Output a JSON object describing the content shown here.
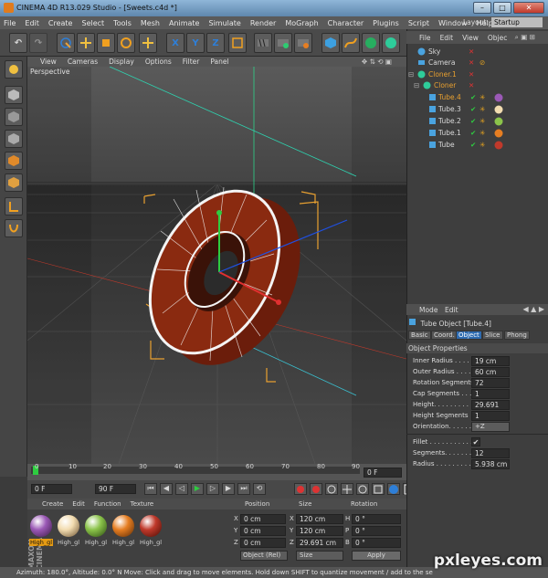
{
  "window": {
    "title": "CINEMA 4D R13.029 Studio - [Sweets.c4d *]"
  },
  "menu": [
    "File",
    "Edit",
    "Create",
    "Select",
    "Tools",
    "Mesh",
    "Animate",
    "Simulate",
    "Render",
    "MoGraph",
    "Character",
    "Plugins",
    "Script",
    "Window",
    "Help"
  ],
  "layout": {
    "label": "Layout:",
    "value": "Startup"
  },
  "toolbar": {
    "x_label": "X",
    "y_label": "Y",
    "z_label": "Z"
  },
  "viewport": {
    "menu": [
      "View",
      "Cameras",
      "Display",
      "Options",
      "Filter",
      "Panel"
    ],
    "label": "Perspective"
  },
  "object_manager": {
    "menu": [
      "File",
      "Edit",
      "View",
      "Objec"
    ],
    "objects": [
      {
        "name": "Sky"
      },
      {
        "name": "Camera"
      },
      {
        "name": "Cloner.1"
      },
      {
        "name": "Cloner"
      },
      {
        "name": "Tube.4"
      },
      {
        "name": "Tube.3"
      },
      {
        "name": "Tube.2"
      },
      {
        "name": "Tube.1"
      },
      {
        "name": "Tube"
      }
    ]
  },
  "attributes": {
    "menu": [
      "Mode",
      "Edit"
    ],
    "title": "Tube Object [Tube.4]",
    "tabs": [
      "Basic",
      "Coord.",
      "Object",
      "Slice",
      "Phong"
    ],
    "section": "Object Properties",
    "fields": [
      {
        "label": "Inner Radius . . . . .",
        "value": "19 cm"
      },
      {
        "label": "Outer Radius . . . . .",
        "value": "60 cm"
      },
      {
        "label": "Rotation Segments",
        "value": "72"
      },
      {
        "label": "Cap Segments . . . .",
        "value": "1"
      },
      {
        "label": "Height. . . . . . . . . .",
        "value": "29.691 cm"
      },
      {
        "label": "Height Segments",
        "value": "1"
      },
      {
        "label": "Orientation. . . . . . .",
        "value": "+Z"
      }
    ],
    "fillet": [
      {
        "label": "Fillet . . . . . . . . . . . .",
        "value": "✔"
      },
      {
        "label": "Segments. . . . . . . .",
        "value": "12"
      },
      {
        "label": "Radius . . . . . . . . . .",
        "value": "5.938 cm"
      }
    ]
  },
  "timeline": {
    "ticks": [
      "0",
      "10",
      "20",
      "30",
      "40",
      "50",
      "60",
      "70",
      "80",
      "90"
    ],
    "current": "0 F",
    "start": "0 F",
    "end": "90 F"
  },
  "materials": {
    "menu": [
      "Create",
      "Edit",
      "Function",
      "Texture"
    ],
    "items": [
      {
        "label": "High_gl",
        "color": "#9b59b6"
      },
      {
        "label": "High_gl",
        "color": "#f2dcb0"
      },
      {
        "label": "High_gl",
        "color": "#8bc34a"
      },
      {
        "label": "High_gl",
        "color": "#e67e22"
      },
      {
        "label": "High_gl",
        "color": "#c0392b"
      }
    ],
    "brand": "MAXON CINEMA 4D"
  },
  "coordinates": {
    "headers": [
      "Position",
      "Size",
      "Rotation"
    ],
    "rows": [
      {
        "axis": "X",
        "pos": "0 cm",
        "sizeaxis": "X",
        "size": "120 cm",
        "rotaxis": "H",
        "rot": "0 °"
      },
      {
        "axis": "Y",
        "pos": "0 cm",
        "sizeaxis": "Y",
        "size": "120 cm",
        "rotaxis": "P",
        "rot": "0 °"
      },
      {
        "axis": "Z",
        "pos": "0 cm",
        "sizeaxis": "Z",
        "size": "29.691 cm",
        "rotaxis": "B",
        "rot": "0 °"
      }
    ],
    "mode": "Object (Rel)",
    "size_mode": "Size",
    "apply": "Apply"
  },
  "status": "Azimuth: 180.0°, Altitude: 0.0°  N    Move: Click and drag to move elements. Hold down SHIFT to quantize movement / add to the se",
  "watermark": "pxleyes.com"
}
